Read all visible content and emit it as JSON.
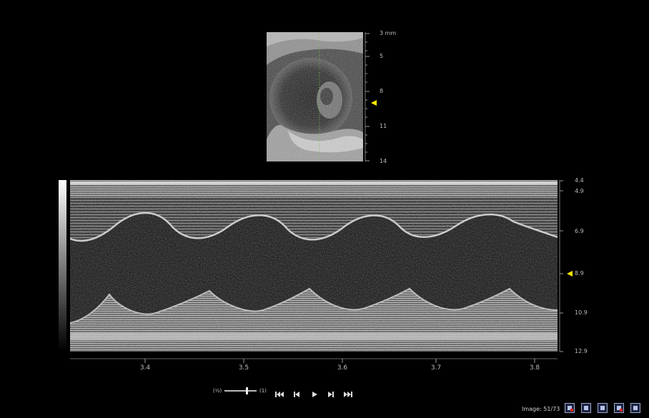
{
  "bmode": {
    "depth_labels": [
      "3 mm",
      "5",
      "8",
      "11",
      "14"
    ],
    "marker_color": "#ffea00"
  },
  "mmode": {
    "depth_labels": [
      "4.4",
      "4.9",
      "6.9",
      "8.9",
      "10.9",
      "12.9"
    ],
    "time_labels": [
      "3.4",
      "3.5",
      "3.6",
      "3.7",
      "3.8"
    ]
  },
  "playback": {
    "slow_label": "(½)",
    "fast_label": "(1)",
    "icons": [
      "first-frame-icon",
      "prev-frame-icon",
      "play-icon",
      "next-frame-icon",
      "last-frame-icon"
    ]
  },
  "footer": {
    "image_counter": "Image: 51/73"
  }
}
